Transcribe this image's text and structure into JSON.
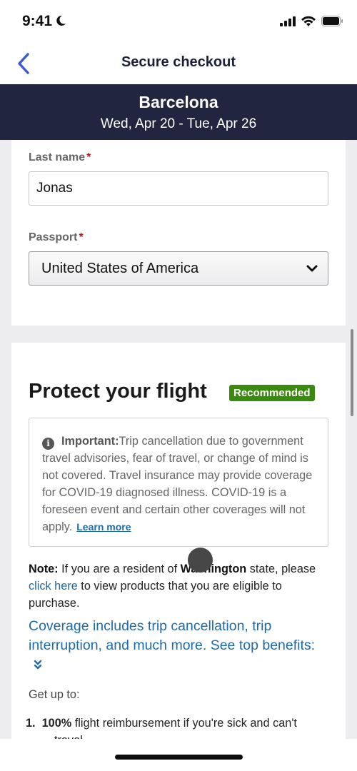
{
  "status_bar": {
    "time": "9:41",
    "icons": [
      "moon-icon",
      "signal-icon",
      "wifi-icon",
      "battery-icon"
    ]
  },
  "nav": {
    "back_icon": "chevron-left-icon",
    "title": "Secure checkout"
  },
  "trip": {
    "city": "Barcelona",
    "dates": "Wed, Apr 20 - Tue, Apr 26"
  },
  "form": {
    "last_name": {
      "label": "Last name",
      "required_mark": "*",
      "value": "Jonas"
    },
    "passport": {
      "label": "Passport",
      "required_mark": "*",
      "selected": "United States of America"
    }
  },
  "protect": {
    "title": "Protect your flight",
    "badge": "Recommended",
    "important": {
      "icon": "info-icon",
      "label": "Important:",
      "text": "Trip cancellation due to government travel advisories, fear of travel, or change of mind is not covered. Travel insurance may provide coverage for COVID-19 diagnosed illness. COVID-19 is a foreseen event and certain other coverages will not apply.",
      "learn_more": "Learn more"
    },
    "note": {
      "label": "Note:",
      "text_1": " If you are a resident of ",
      "state": "Washington",
      "text_2": " state, please ",
      "link": "click here",
      "text_3": " to view products that you are eligible to purchase."
    },
    "coverage_link": "Coverage includes trip cancellation, trip interruption, and much more. See top benefits:",
    "expand_icon": "double-chevron-down-icon",
    "get_up_to": "Get up to:",
    "benefits": [
      {
        "num": "1.",
        "bold": "100%",
        "text": " flight reimbursement if you're sick and can't",
        "cont": "travel"
      }
    ]
  },
  "colors": {
    "header_bg": "#22253f",
    "badge_green": "#3a8a10",
    "link_blue": "#1a6aaa",
    "required_red": "#a3203a",
    "back_blue": "#3b5bd6"
  }
}
